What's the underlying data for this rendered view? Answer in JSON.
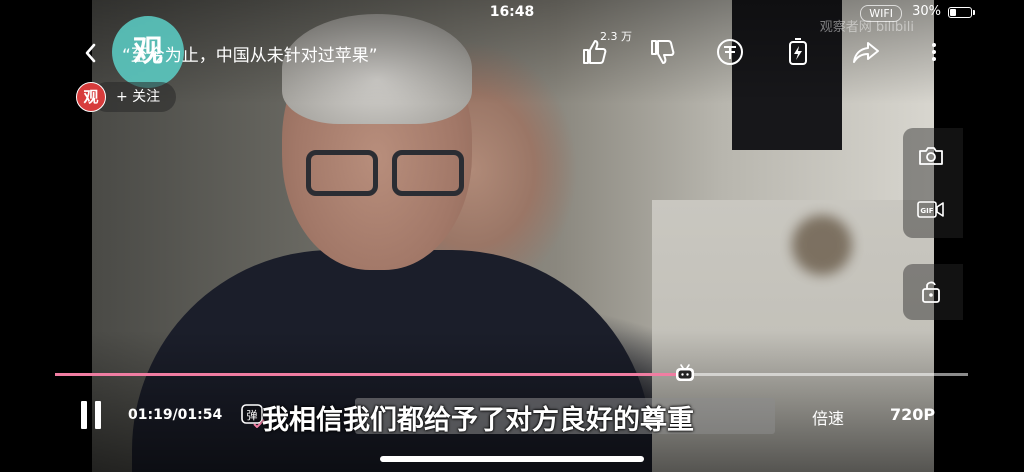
{
  "status": {
    "time": "16:48",
    "wifi": "WIFI",
    "battery_pct": "30%",
    "battery_level": 0.3
  },
  "video": {
    "title": "“至今为止，中国从未针对过苹果”",
    "channel_logo_char": "观",
    "watermark": "观察者网 bilibili",
    "like_count": "2.3 万",
    "follow_label": "+ 关注",
    "avatar_char": "观"
  },
  "icons": {
    "back": "chevron-left-icon",
    "like": "thumbs-up-icon",
    "dislike": "thumbs-down-icon",
    "coin": "coin-icon",
    "charge": "battery-charge-icon",
    "share": "share-icon",
    "more": "more-vertical-icon",
    "screenshot": "camera-icon",
    "gif": "gif-record-icon",
    "lock": "lock-icon",
    "play_pause": "pause-icon",
    "danmu": "danmaku-toggle-icon",
    "progress_thumb": "tv-thumb-icon"
  },
  "player": {
    "timecode": "01:19/01:54",
    "progress": 0.69,
    "danmu_label": "弹",
    "speed_label": "倍速",
    "quality_label": "720P",
    "subtitle": "我相信我们都给予了对方良好的尊重",
    "accent": "#f07da2"
  },
  "side_tools": {
    "gif_label": "GIF"
  }
}
